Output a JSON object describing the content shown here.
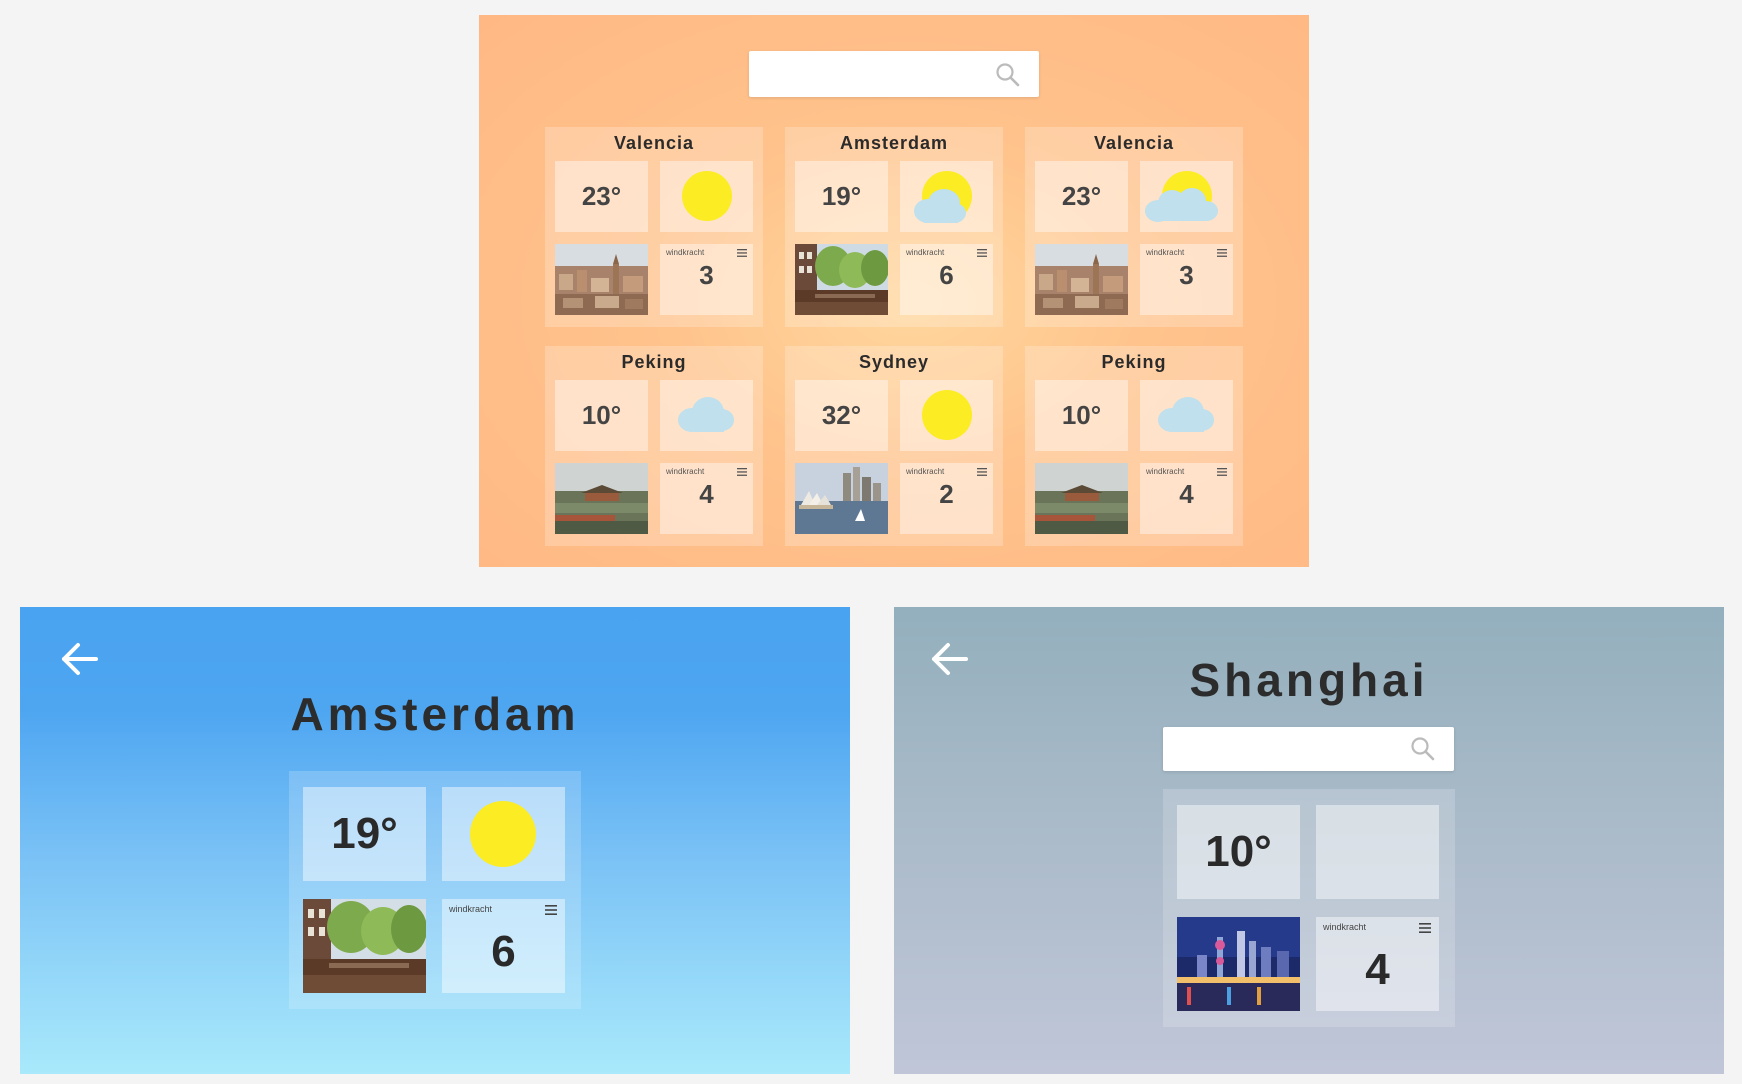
{
  "overview": {
    "search": {
      "placeholder": ""
    },
    "wind_label": "windkracht",
    "cards": [
      {
        "city": "Valencia",
        "temp": "23°",
        "weather": "sun",
        "photo": "valencia",
        "wind": "3"
      },
      {
        "city": "Amsterdam",
        "temp": "19°",
        "weather": "sun-cloud",
        "photo": "amsterdam",
        "wind": "6"
      },
      {
        "city": "Valencia",
        "temp": "23°",
        "weather": "sun-clouds",
        "photo": "valencia",
        "wind": "3"
      },
      {
        "city": "Peking",
        "temp": "10°",
        "weather": "cloud",
        "photo": "peking",
        "wind": "4"
      },
      {
        "city": "Sydney",
        "temp": "32°",
        "weather": "sun",
        "photo": "sydney",
        "wind": "2"
      },
      {
        "city": "Peking",
        "temp": "10°",
        "weather": "cloud",
        "photo": "peking",
        "wind": "4"
      }
    ]
  },
  "amsterdam_detail": {
    "title": "Amsterdam",
    "temp": "19°",
    "weather": "sun",
    "wind_label": "windkracht",
    "wind": "6"
  },
  "shanghai_detail": {
    "title": "Shanghai",
    "search": {
      "placeholder": ""
    },
    "temp": "10°",
    "weather": "none",
    "wind_label": "windkracht",
    "wind": "4"
  },
  "icons": {
    "search": "search-icon",
    "back": "arrow-left-icon",
    "menu": "menu-icon",
    "sun": "sun-icon",
    "cloud": "cloud-icon"
  },
  "colors": {
    "overview_bg": "#ffbf88",
    "amsterdam_bg_top": "#4aa3f0",
    "amsterdam_bg_bottom": "#a9e9fb",
    "shanghai_bg_top": "#93afbd",
    "shanghai_bg_bottom": "#c0c6d8",
    "sun": "#fbec23",
    "cloud": "#bfe0ec"
  }
}
